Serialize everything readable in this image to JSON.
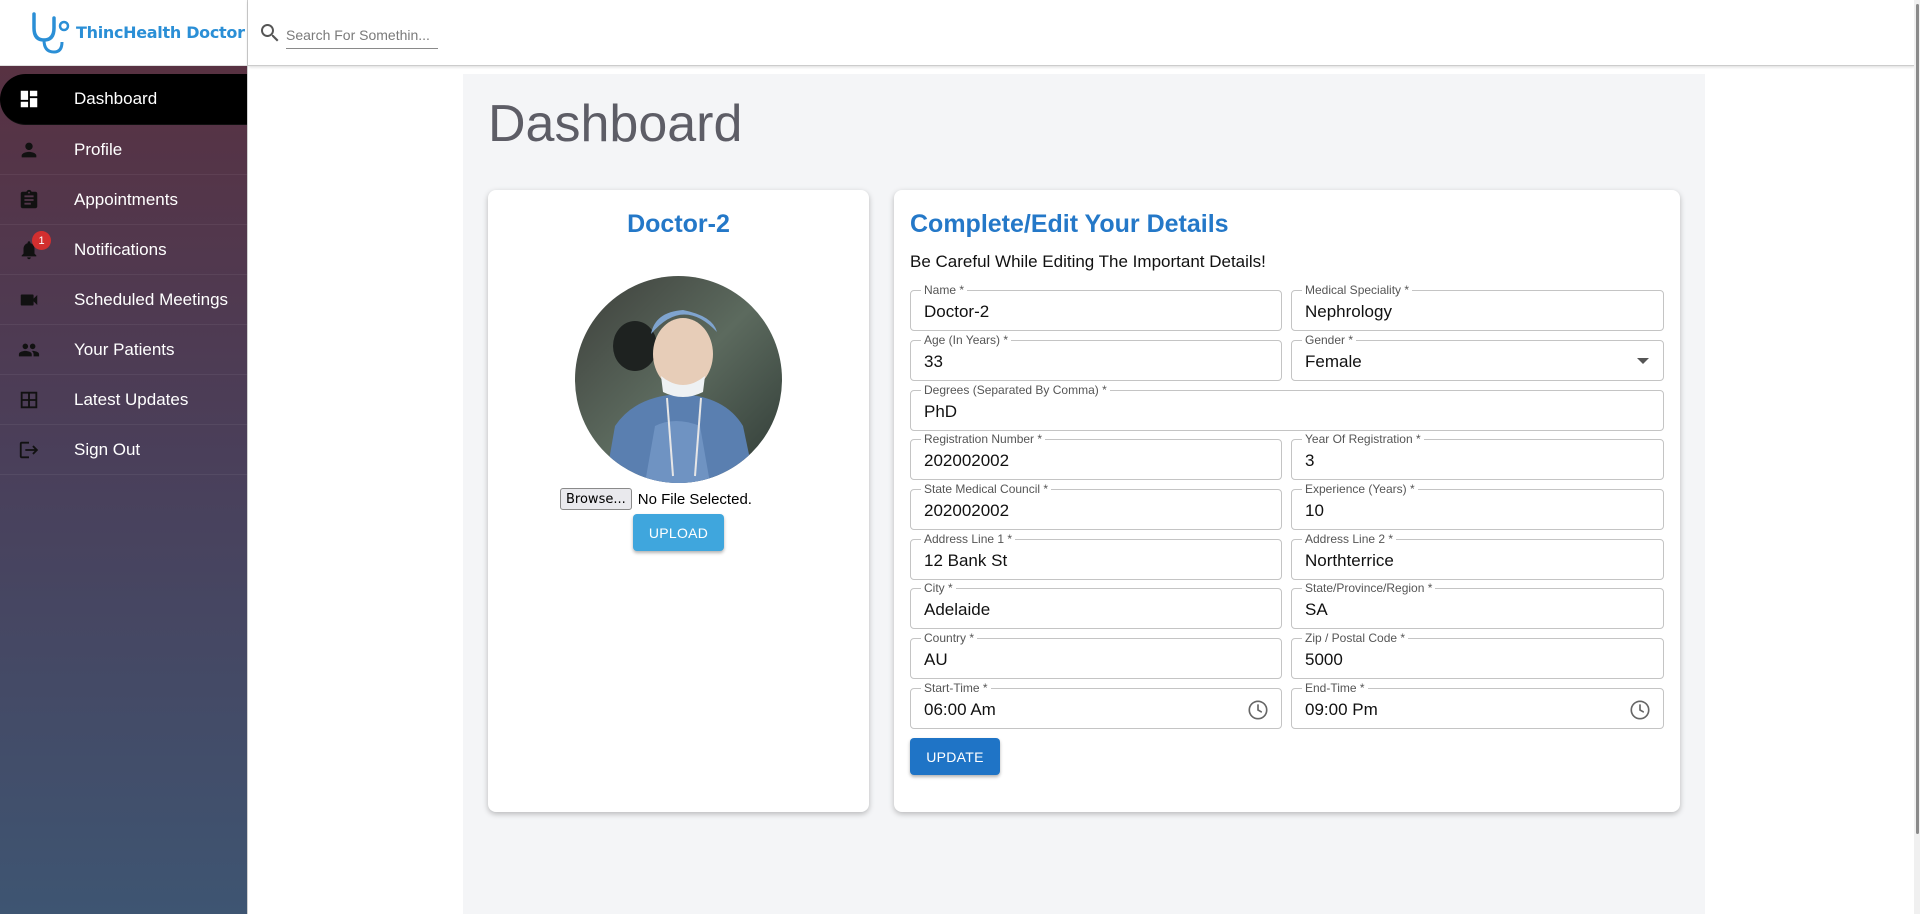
{
  "app": {
    "brand": "ThincHealth Doctor"
  },
  "search": {
    "placeholder": "Search For Somethin..."
  },
  "sidebar": {
    "items": [
      {
        "label": "Dashboard",
        "icon": "dashboard-icon",
        "active": true
      },
      {
        "label": "Profile",
        "icon": "person-icon"
      },
      {
        "label": "Appointments",
        "icon": "clipboard-icon"
      },
      {
        "label": "Notifications",
        "icon": "bell-icon",
        "badge": "1"
      },
      {
        "label": "Scheduled Meetings",
        "icon": "video-camera-icon"
      },
      {
        "label": "Your Patients",
        "icon": "people-icon"
      },
      {
        "label": "Latest Updates",
        "icon": "table-icon"
      },
      {
        "label": "Sign Out",
        "icon": "logout-icon"
      }
    ]
  },
  "page": {
    "title": "Dashboard"
  },
  "profile_card": {
    "name": "Doctor-2",
    "browse_label": "Browse...",
    "file_status": "No File Selected.",
    "upload_label": "UPLOAD"
  },
  "form": {
    "title": "Complete/Edit Your Details",
    "subtitle": "Be Careful While Editing The Important Details!",
    "fields": {
      "name": {
        "label": "Name *",
        "value": "Doctor-2"
      },
      "speciality": {
        "label": "Medical Speciality *",
        "value": "Nephrology"
      },
      "age": {
        "label": "Age (In Years) *",
        "value": "33"
      },
      "gender": {
        "label": "Gender *",
        "value": "Female"
      },
      "degrees": {
        "label": "Degrees (Separated By Comma) *",
        "value": "PhD"
      },
      "reg_number": {
        "label": "Registration Number *",
        "value": "202002002"
      },
      "reg_year": {
        "label": "Year Of Registration *",
        "value": "3"
      },
      "state_council": {
        "label": "State Medical Council *",
        "value": "202002002"
      },
      "experience": {
        "label": "Experience (Years) *",
        "value": "10"
      },
      "address1": {
        "label": "Address Line 1 *",
        "value": "12 Bank St"
      },
      "address2": {
        "label": "Address Line 2 *",
        "value": "Northterrice"
      },
      "city": {
        "label": "City *",
        "value": "Adelaide"
      },
      "state": {
        "label": "State/Province/Region *",
        "value": "SA"
      },
      "country": {
        "label": "Country *",
        "value": "AU"
      },
      "zip": {
        "label": "Zip / Postal Code *",
        "value": "5000"
      },
      "start_time": {
        "label": "Start-Time *",
        "value": "06:00 Am"
      },
      "end_time": {
        "label": "End-Time *",
        "value": "09:00 Pm"
      }
    },
    "update_label": "UPDATE"
  },
  "colors": {
    "accent": "#2478c8",
    "upload": "#3fa6dd",
    "update": "#1f74c6",
    "badge": "#d32f2f"
  }
}
